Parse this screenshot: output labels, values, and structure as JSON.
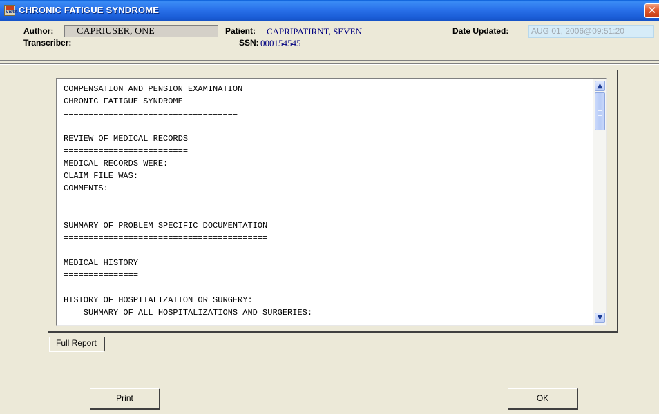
{
  "window": {
    "title": "CHRONIC FATIGUE SYNDROME",
    "icon": "app-logo-icon",
    "icon_text": "VistA",
    "close_icon": "close-icon"
  },
  "header": {
    "author_label": "Author:",
    "author_value": "CAPRIUSER, ONE",
    "transcriber_label": "Transcriber:",
    "patient_label": "Patient:",
    "patient_value": "CAPRIPATIRNT, SEVEN",
    "ssn_label": "SSN:",
    "ssn_value": "000154545",
    "date_label": "Date Updated:",
    "date_value": "AUG 01, 2006@09:51:20"
  },
  "report": {
    "lines": [
      "COMPENSATION AND PENSION EXAMINATION",
      "CHRONIC FATIGUE SYNDROME",
      "===================================",
      "",
      "REVIEW OF MEDICAL RECORDS",
      "=========================",
      "MEDICAL RECORDS WERE:",
      "CLAIM FILE WAS:",
      "COMMENTS:",
      "",
      "",
      "SUMMARY OF PROBLEM SPECIFIC DOCUMENTATION",
      "=========================================",
      "",
      "MEDICAL HISTORY",
      "===============",
      "",
      "HISTORY OF HOSPITALIZATION OR SURGERY:",
      "    SUMMARY OF ALL HOSPITALIZATIONS AND SURGERIES:"
    ],
    "scroll_position": 0.0
  },
  "tabs": [
    {
      "label": "Full Report",
      "selected": true
    }
  ],
  "buttons": {
    "print_label_accel": "P",
    "print_label_rest": "rint",
    "ok_label_accel": "O",
    "ok_label_rest": "K"
  },
  "colors": {
    "titlebar": "#1c5fd9",
    "window_bg": "#ece9d8",
    "value_text": "#000080",
    "close_button": "#e0582c"
  }
}
